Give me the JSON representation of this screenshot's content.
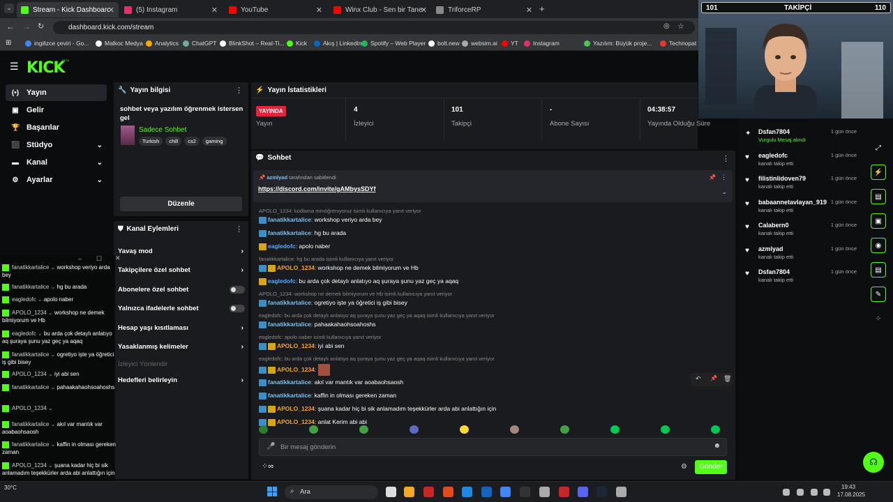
{
  "browser": {
    "tabs": [
      {
        "label": "Stream - Kick Dashboard",
        "active": true,
        "color": "#53fc18"
      },
      {
        "label": "(5) Instagram",
        "color": "#e1306c"
      },
      {
        "label": "YouTube",
        "color": "#ff0000"
      },
      {
        "label": "Winx Club - Sen bir Tanesin - W",
        "color": "#ff0000"
      },
      {
        "label": "TriforceRP",
        "color": "#888888"
      }
    ],
    "url": "dashboard.kick.com/stream",
    "bookmarks": [
      "ingilizce çeviri - Go...",
      "Malkoc Medya",
      "Analytics",
      "ChatGPT",
      "BlinkShot – Real-Ti...",
      "Kick",
      "Akış | LinkedIn",
      "Spotify – Web Player",
      "bolt.new",
      "websim.ai",
      "YT",
      "Instagram",
      "Yazılım: Büyük proje...",
      "Technopat So"
    ]
  },
  "kick": {
    "logo": "KICK",
    "beta": "BETA"
  },
  "sidebar": {
    "items": [
      "Yayın",
      "Gelir",
      "Başarılar",
      "Stüdyo",
      "Kanal",
      "Ayarlar"
    ]
  },
  "stream_info": {
    "title": "Yayın bilgisi",
    "stream_title": "sohbet veya yazılım öğrenmek istersen gel",
    "category": "Sadece Sohbet",
    "tags": [
      "Turkish",
      "chill",
      "cs2",
      "gaming"
    ],
    "edit": "Düzenle"
  },
  "stats": {
    "title": "Yayın İstatistikleri",
    "live": "YAYINDA",
    "live_label": "Yayın",
    "viewers": "4",
    "viewers_label": "İzleyici",
    "followers": "101",
    "followers_label": "Takipçi",
    "subs": "-",
    "subs_label": "Abone Sayısı",
    "uptime": "04:38:57",
    "uptime_label": "Yayında Olduğu Süre"
  },
  "channel_actions": {
    "title": "Kanal Eylemleri",
    "items": [
      "Yavaş mod",
      "Takipçilere özel sohbet",
      "Abonelere özel sohbet",
      "Yalnızca ifadelerle sohbet",
      "Hesap yaşı kısıtlaması",
      "Yasaklanmış kelimeler",
      "İzleyici Yönlendir",
      "Hedefleri belirleyin"
    ]
  },
  "chat": {
    "title": "Sohbet",
    "pinned_by": "azmlyad",
    "pinned_suffix": "tarafından sabitlendi",
    "pinned_link": "https://discord.com/invite/gAMbysSDYf",
    "placeholder": "Bir mesaj gönderin",
    "send": "Gönder",
    "messages": [
      {
        "reply": "APOLO_1234: kodlama mmöğrenıyoruz isimli kullanıcıya yanıt veriyor"
      },
      {
        "user": "fanatikkartalice",
        "text": "workshop veriyo arda bey",
        "cls": "un-k",
        "badges": [
          "b-blue"
        ]
      },
      {
        "user": "fanatikkartalice",
        "text": "hg bu arada",
        "cls": "un-k",
        "badges": [
          "b-blue"
        ]
      },
      {
        "user": "eagledofc",
        "text": "apolo naber",
        "cls": "un-e",
        "badges": [
          "b-gold"
        ]
      },
      {
        "reply": "fanatikkartalice: hg bu arada isimli kullanıcıya yanıt veriyor"
      },
      {
        "user": "APOLO_1234",
        "text": "workshop ne demek bilmiyorum ve Hb",
        "cls": "un-a",
        "badges": [
          "b-blue",
          "b-gold"
        ]
      },
      {
        "user": "eagledofc",
        "text": "bu arda çok detaylı anlatıyo aq şuraya şunu yaz geç ya aqaq",
        "cls": "un-e",
        "badges": [
          "b-gold"
        ]
      },
      {
        "reply": "APOLO_1234: workshop ne demek bilmiyorum ve Hb isimli kullanıcıya yanıt veriyor"
      },
      {
        "user": "fanatikkartalice",
        "text": "ogretiyo işte ya öğretici iş gibi bisey",
        "cls": "un-k",
        "badges": [
          "b-blue"
        ]
      },
      {
        "reply": "eagledofc: bu arda çok detaylı anlatıyo aq şuraya şunu yaz geç ya aqaq isimli kullanıcıya yanıt veriyor"
      },
      {
        "user": "fanatikkartalice",
        "text": "pahaakahaohsoahoshs",
        "cls": "un-k",
        "badges": [
          "b-blue"
        ]
      },
      {
        "reply": "eagledofc: apolo naber isimli kullanıcıya yanıt veriyor"
      },
      {
        "user": "APOLO_1234",
        "text": "iyi abi sen",
        "cls": "un-a",
        "badges": [
          "b-blue",
          "b-gold"
        ]
      },
      {
        "reply": "eagledofc: bu arda çok detaylı anlatıyo aq şuraya şunu yaz geç ya aqaq isimli kullanıcıya yanıt veriyor"
      },
      {
        "user": "APOLO_1234",
        "text": "",
        "cls": "un-a",
        "badges": [
          "b-blue",
          "b-gold"
        ],
        "emote": true
      },
      {
        "user": "fanatikkartalice",
        "text": "akıl var mantık var aoabaohsaosh",
        "cls": "un-k",
        "badges": [
          "b-blue"
        ]
      },
      {
        "user": "fanatikkartalice",
        "text": "kaffin in olması gereken zaman",
        "cls": "un-k",
        "badges": [
          "b-blue"
        ]
      },
      {
        "user": "APOLO_1234",
        "text": "şuana kadar hiç bi sik anlamadım teşekkürler arda abi anlattığın için",
        "cls": "un-a",
        "badges": [
          "b-blue",
          "b-gold"
        ]
      },
      {
        "user": "APOLO_1234",
        "text": "anlat Kerim abi abi",
        "cls": "un-a",
        "badges": [
          "b-blue",
          "b-gold"
        ]
      }
    ]
  },
  "overlay_chat": [
    {
      "user": "fanatikkartalice",
      "text": "workshop veriyo arda bey"
    },
    {
      "user": "fanatikkartalice",
      "text": "hg bu arada"
    },
    {
      "user": "eagledofc",
      "text": "apolo naber"
    },
    {
      "user": "APOLO_1234",
      "text": "workshop ne demek bilmiyorum ve Hb"
    },
    {
      "user": "eagledofc",
      "text": "bu arda çok detaylı anlatıyo aq şuraya şunu yaz geç ya aqaq"
    },
    {
      "user": "fanatikkartalice",
      "text": "ogretiyo işte ya öğretici iş gibi bisey"
    },
    {
      "user": "APOLO_1234",
      "text": "iyi abi sen"
    },
    {
      "user": "fanatikkartalice",
      "text": "pahaakahaohsoahoshs"
    },
    {
      "user": "APOLO_1234",
      "text": ""
    },
    {
      "user": "fanatikkartalice",
      "text": "akıl var mantık var aoabaohsaosh"
    },
    {
      "user": "fanatikkartalice",
      "text": "kaffin in olması gereken zaman"
    },
    {
      "user": "APOLO_1234",
      "text": "şuana kadar hiç bi sik anlamadım teşekkürler arda abi anlattığın için"
    },
    {
      "user": "APOLO_1234",
      "text": "anlat Kerim abi abi"
    }
  ],
  "followers_feed": [
    {
      "name": "Dsfan7804",
      "sub": "Vurgulu Mesaj alındı",
      "time": "1 gün önce"
    },
    {
      "name": "eagledofc",
      "sub": "kanalı takip etti",
      "time": "1 gün önce"
    },
    {
      "name": "filistinlidoven79",
      "sub": "kanalı takip etti",
      "time": "1 gün önce"
    },
    {
      "name": "babaannetavlayan_919",
      "sub": "kanalı takip etti",
      "time": "1 gün önce"
    },
    {
      "name": "Calabern0",
      "sub": "kanalı takip etti",
      "time": "1 gün önce"
    },
    {
      "name": "azmlyad",
      "sub": "kanalı takip etti",
      "time": "1 gün önce"
    },
    {
      "name": "Dsfan7804",
      "sub": "kanalı takip etti",
      "time": "1 gün önce"
    }
  ],
  "webcam": {
    "count": "101",
    "label": "TAKİPÇİ",
    "goal": "110"
  },
  "taskbar": {
    "search": "Ara",
    "weather": "30°C",
    "clock": "19:43",
    "date": "17.08.2025"
  }
}
